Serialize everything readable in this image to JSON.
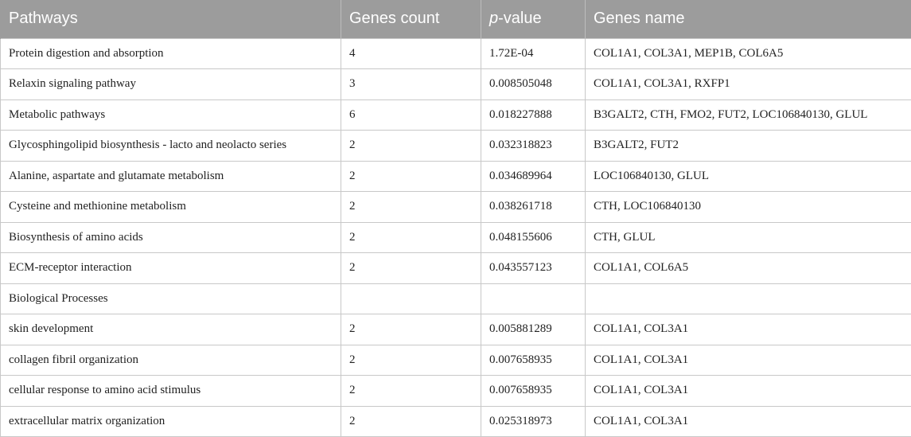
{
  "header": {
    "pathways": "Pathways",
    "genes_count": "Genes count",
    "p_prefix": "p",
    "p_suffix": "-value",
    "genes_name": "Genes name"
  },
  "rows": [
    {
      "pathway": "Protein digestion and absorption",
      "count": "4",
      "pvalue": "1.72E-04",
      "genes": "COL1A1, COL3A1, MEP1B, COL6A5"
    },
    {
      "pathway": "Relaxin signaling pathway",
      "count": "3",
      "pvalue": "0.008505048",
      "genes": "COL1A1, COL3A1, RXFP1"
    },
    {
      "pathway": "Metabolic pathways",
      "count": "6",
      "pvalue": "0.018227888",
      "genes": "B3GALT2, CTH, FMO2, FUT2, LOC106840130, GLUL"
    },
    {
      "pathway": "Glycosphingolipid biosynthesis - lacto and neolacto series",
      "count": "2",
      "pvalue": "0.032318823",
      "genes": "B3GALT2, FUT2"
    },
    {
      "pathway": "Alanine, aspartate and glutamate metabolism",
      "count": "2",
      "pvalue": "0.034689964",
      "genes": "LOC106840130, GLUL"
    },
    {
      "pathway": "Cysteine and methionine metabolism",
      "count": "2",
      "pvalue": "0.038261718",
      "genes": "CTH, LOC106840130"
    },
    {
      "pathway": "Biosynthesis of amino acids",
      "count": "2",
      "pvalue": "0.048155606",
      "genes": "CTH, GLUL"
    },
    {
      "pathway": "ECM-receptor interaction",
      "count": "2",
      "pvalue": "0.043557123",
      "genes": "COL1A1, COL6A5"
    },
    {
      "pathway": "Biological Processes",
      "count": "",
      "pvalue": "",
      "genes": ""
    },
    {
      "pathway": "skin development",
      "count": "2",
      "pvalue": "0.005881289",
      "genes": "COL1A1, COL3A1"
    },
    {
      "pathway": "collagen fibril organization",
      "count": "2",
      "pvalue": "0.007658935",
      "genes": "COL1A1, COL3A1"
    },
    {
      "pathway": "cellular response to amino acid stimulus",
      "count": "2",
      "pvalue": "0.007658935",
      "genes": "COL1A1, COL3A1"
    },
    {
      "pathway": "extracellular matrix organization",
      "count": "2",
      "pvalue": "0.025318973",
      "genes": "COL1A1, COL3A1"
    }
  ]
}
